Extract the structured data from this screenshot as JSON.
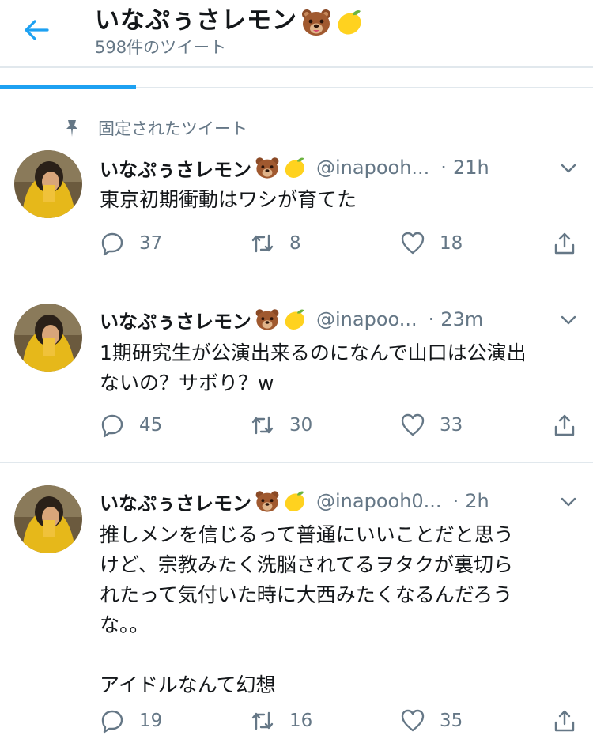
{
  "header": {
    "title": "いなぷぅさレモン",
    "title_emoji": [
      "bear-face-icon",
      "lemon-icon"
    ],
    "tweet_count": "598件のツイート"
  },
  "colors": {
    "accent": "#1da1f2",
    "muted": "#657786",
    "text": "#14171a",
    "divider": "#e1e8ed"
  },
  "pinned": {
    "label": "固定されたツイート"
  },
  "tweets": [
    {
      "name": "いなぷぅさレモン",
      "handle": "@inapooh...",
      "separator": "·",
      "time": "21h",
      "text": "東京初期衝動はワシが育てた",
      "replies": "37",
      "retweets": "8",
      "likes": "18"
    },
    {
      "name": "いなぷぅさレモン",
      "handle": "@inapoo...",
      "separator": "·",
      "time": "23m",
      "text": "1期研究生が公演出来るのになんで山口は公演出\nないの？サボり？w",
      "replies": "45",
      "retweets": "30",
      "likes": "33"
    },
    {
      "name": "いなぷぅさレモン",
      "handle": "@inapooh0...",
      "separator": "·",
      "time": "2h",
      "text": "推しメンを信じるって普通にいいことだと思う\nけど、宗教みたく洗脳されてるヲタクが裏切ら\nれたって気付いた時に大西みたくなるんだろう\nな。。\n\nアイドルなんて幻想",
      "replies": "19",
      "retweets": "16",
      "likes": "35"
    }
  ]
}
